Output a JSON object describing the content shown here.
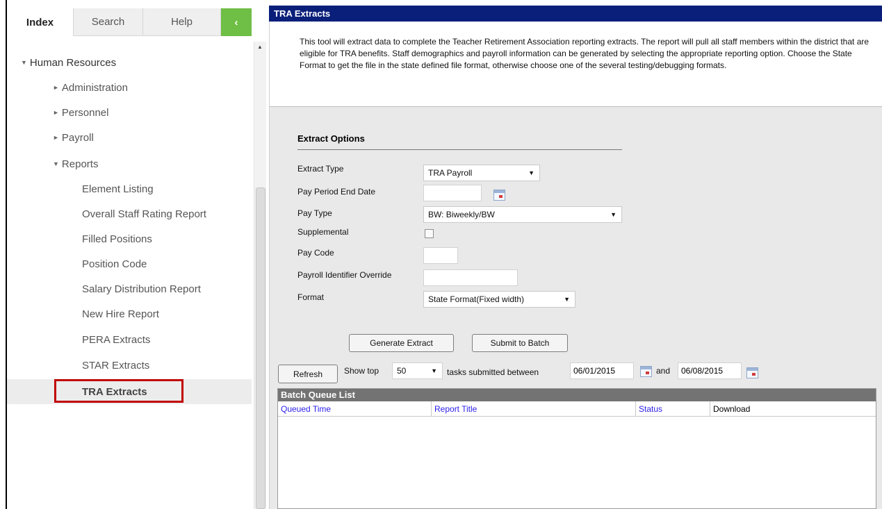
{
  "sidebar": {
    "tabs": [
      {
        "label": "Index",
        "active": true
      },
      {
        "label": "Search",
        "active": false
      },
      {
        "label": "Help",
        "active": false
      }
    ],
    "collapse_glyph": "‹",
    "tree": [
      {
        "label": "Human Resources",
        "expanded": true
      },
      {
        "label": "Administration",
        "expanded": false
      },
      {
        "label": "Personnel",
        "expanded": false
      },
      {
        "label": "Payroll",
        "expanded": false
      },
      {
        "label": "Reports",
        "expanded": true
      },
      {
        "label": "Element Listing"
      },
      {
        "label": "Overall Staff Rating Report"
      },
      {
        "label": "Filled Positions"
      },
      {
        "label": "Position Code"
      },
      {
        "label": "Salary Distribution Report"
      },
      {
        "label": "New Hire Report"
      },
      {
        "label": "PERA Extracts"
      },
      {
        "label": "STAR Extracts"
      },
      {
        "label": "TRA Extracts",
        "selected": true
      }
    ],
    "highlight_color": "#c00000"
  },
  "main": {
    "title": "TRA Extracts",
    "description": "This tool will extract data to complete the Teacher Retirement Association reporting extracts. The report will pull all staff members within the district that are eligible for TRA benefits. Staff demographics and payroll information can be generated by selecting the appropriate reporting option. Choose the State Format to get the file in the state defined file format, otherwise choose one of the several testing/debugging formats.",
    "section_title": "Extract Options",
    "fields": {
      "extract_type": {
        "label": "Extract Type",
        "value": "TRA Payroll"
      },
      "pay_period_end": {
        "label": "Pay Period End Date",
        "value": ""
      },
      "pay_type": {
        "label": "Pay Type",
        "value": "BW: Biweekly/BW"
      },
      "supplemental": {
        "label": "Supplemental",
        "checked": false
      },
      "pay_code": {
        "label": "Pay Code",
        "value": ""
      },
      "payroll_override": {
        "label": "Payroll Identifier Override",
        "value": ""
      },
      "format": {
        "label": "Format",
        "value": "State Format(Fixed width)"
      }
    },
    "buttons": {
      "generate": "Generate Extract",
      "submit": "Submit to Batch",
      "refresh": "Refresh"
    },
    "batch_filter": {
      "show_top_label": "Show top",
      "show_top_value": "50",
      "between_label": "tasks submitted between",
      "start_date": "06/01/2015",
      "and_label": "and",
      "end_date": "06/08/2015"
    },
    "queue": {
      "title": "Batch Queue List",
      "columns": [
        "Queued Time",
        "Report Title",
        "Status",
        "Download"
      ]
    },
    "colors": {
      "title_bar": "#0a1f7a",
      "accent_green": "#6fbe45",
      "link_blue": "#2a1ee8"
    }
  }
}
